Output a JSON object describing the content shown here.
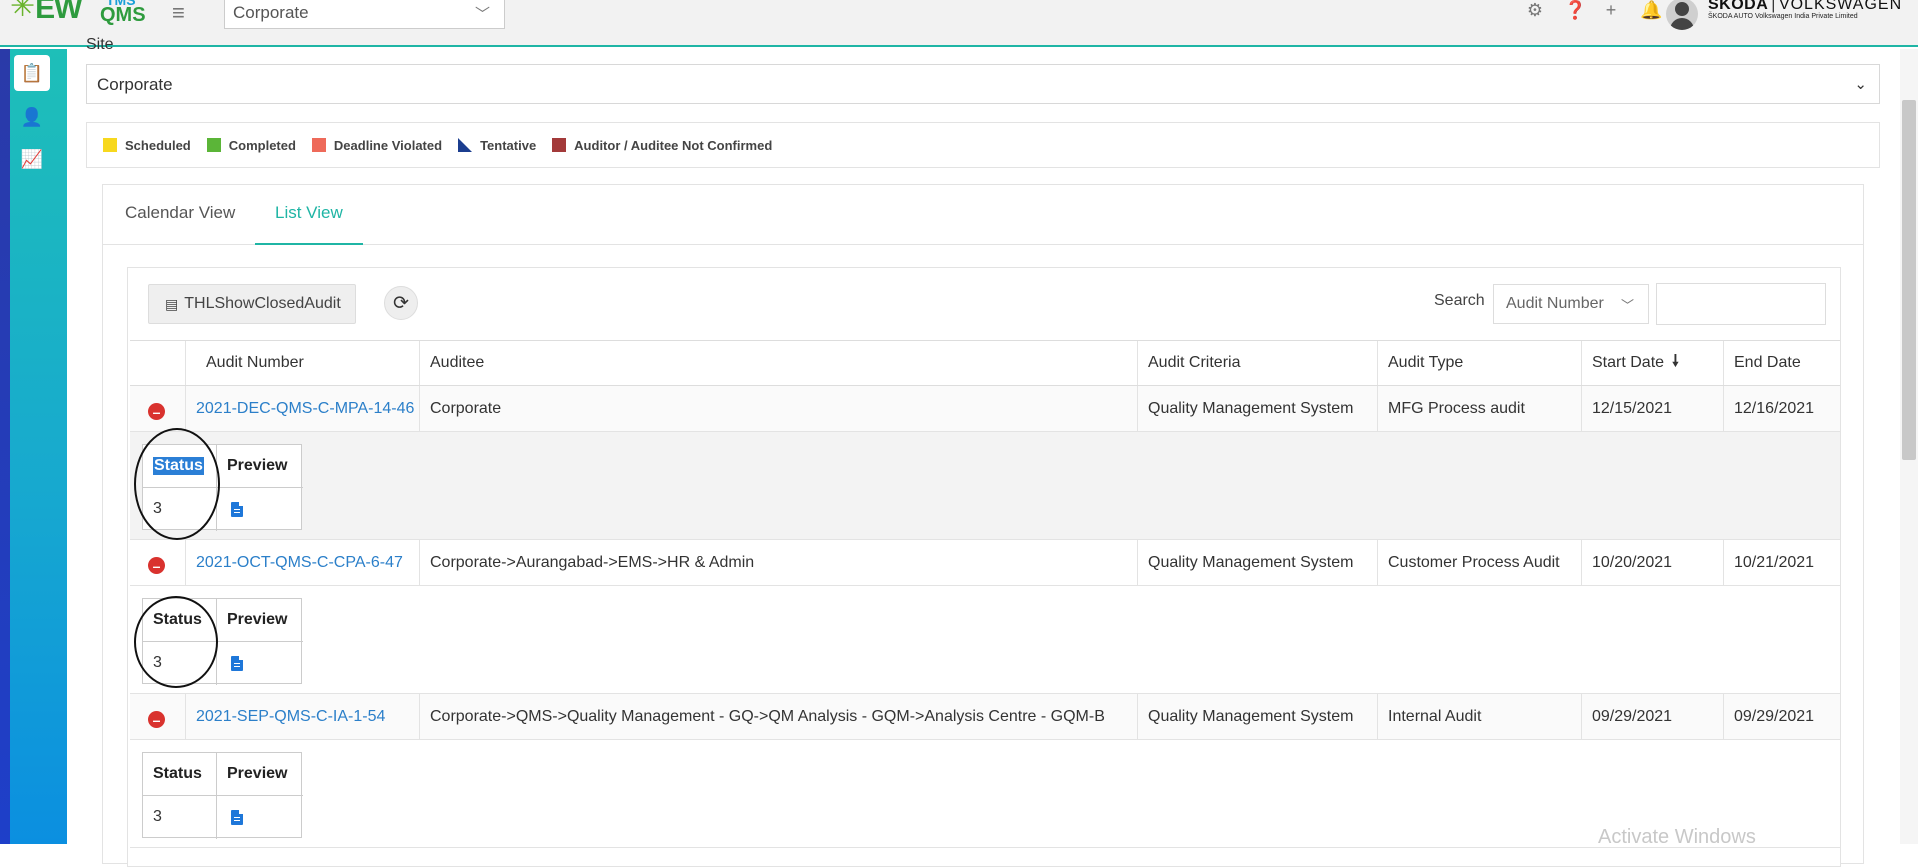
{
  "topbar": {
    "logo_tms": "TMS",
    "logo_ew": "EW",
    "logo_qms": "QMS",
    "org_select": "Corporate",
    "brand_skoda": "ŠKODA",
    "brand_vw": "VOLKSWAGEN",
    "brand_sub": "ŠKODA AUTO Volkswagen India Private Limited",
    "icons": [
      "gear-icon",
      "help-icon",
      "plus-icon",
      "bell-icon"
    ]
  },
  "site": {
    "label": "Site",
    "value": "Corporate"
  },
  "legend": [
    {
      "label": "Scheduled",
      "color": "#f7d81e"
    },
    {
      "label": "Completed",
      "color": "#5bb538"
    },
    {
      "label": "Deadline Violated",
      "color": "#ee6a5a"
    },
    {
      "label": "Tentative",
      "color": "#1b3d8f"
    },
    {
      "label": "Auditor / Auditee Not Confirmed",
      "color": "#a33a3a"
    }
  ],
  "tabs": {
    "calendar": "Calendar View",
    "list": "List View"
  },
  "toolbar": {
    "closed_btn": "THLShowClosedAudit",
    "search_label": "Search",
    "search_field": "Audit Number",
    "search_value": ""
  },
  "table": {
    "headers": [
      "Audit Number",
      "Auditee",
      "Audit Criteria",
      "Audit Type",
      "Start Date",
      "End Date"
    ],
    "sort_indicator": "🠗",
    "rows": [
      {
        "number": "2021-DEC-QMS-C-MPA-14-46",
        "auditee": "Corporate",
        "criteria": "Quality Management System",
        "type": "MFG Process audit",
        "start": "12/15/2021",
        "end": "12/16/2021",
        "status": "3"
      },
      {
        "number": "2021-OCT-QMS-C-CPA-6-47",
        "auditee": "Corporate->Aurangabad->EMS->HR & Admin",
        "criteria": "Quality Management System",
        "type": "Customer Process Audit",
        "start": "10/20/2021",
        "end": "10/21/2021",
        "status": "3"
      },
      {
        "number": "2021-SEP-QMS-C-IA-1-54",
        "auditee": "Corporate->QMS->Quality Management - GQ->QM Analysis - GQM->Analysis Centre - GQM-B",
        "criteria": "Quality Management System",
        "type": "Internal Audit",
        "start": "09/29/2021",
        "end": "09/29/2021",
        "status": "3"
      }
    ],
    "sub_headers": {
      "status": "Status",
      "preview": "Preview"
    }
  },
  "watermark": "Activate Windows"
}
